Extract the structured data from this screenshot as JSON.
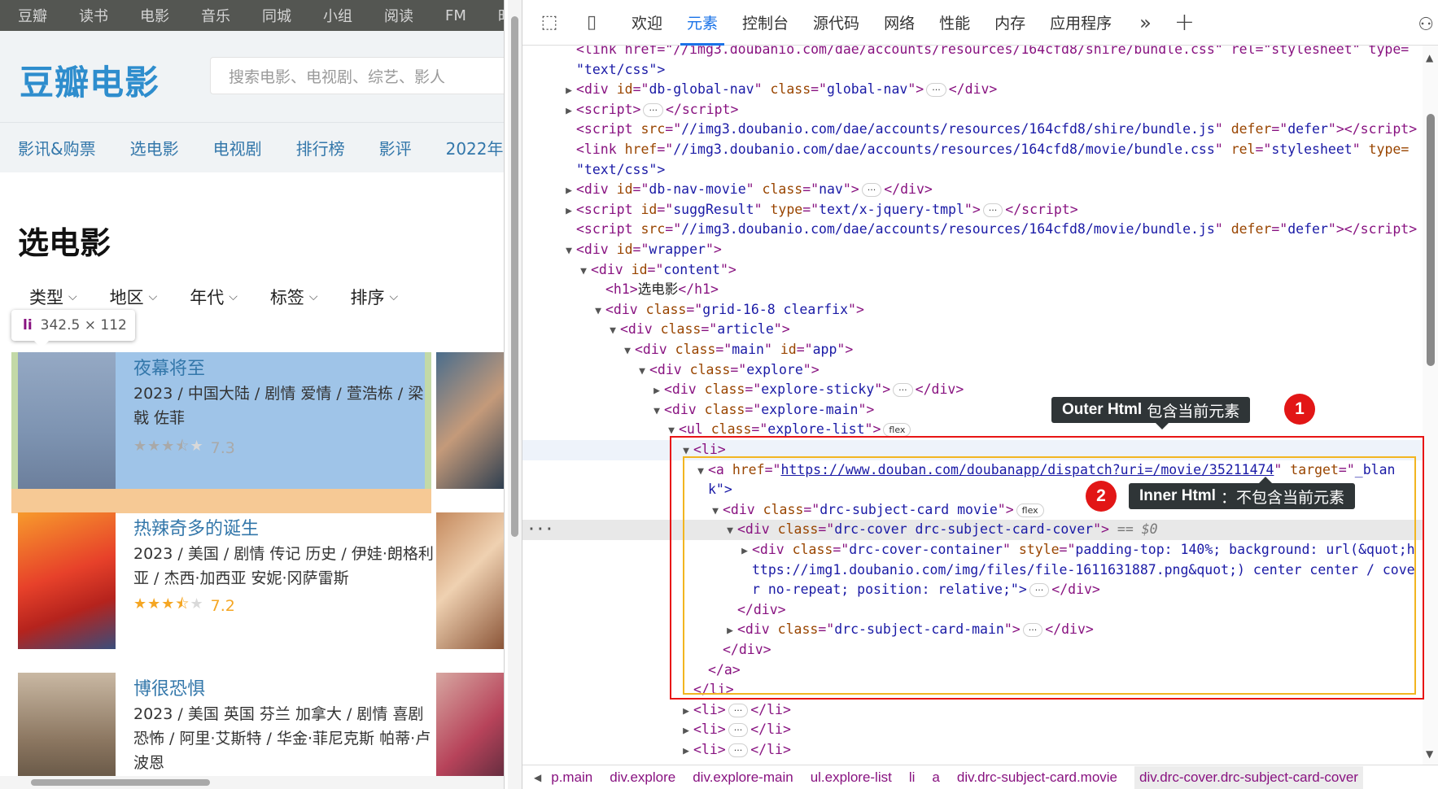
{
  "global_nav": [
    "豆瓣",
    "读书",
    "电影",
    "音乐",
    "同城",
    "小组",
    "阅读",
    "FM",
    "时间"
  ],
  "logo": "豆瓣电影",
  "search": {
    "placeholder": "搜索电影、电视剧、综艺、影人"
  },
  "movie_nav": [
    "影讯&购票",
    "选电影",
    "电视剧",
    "排行榜",
    "影评",
    "2022年"
  ],
  "page_title": "选电影",
  "filters": [
    "类型",
    "地区",
    "年代",
    "标签",
    "排序"
  ],
  "tooltip": {
    "tag": "li",
    "dims": "342.5 × 112"
  },
  "movies": [
    {
      "title": "夜幕将至",
      "meta": "2023 / 中国大陆 / 剧情 爱情 / 萱浩栋 / 梁戟 佐菲",
      "score": "7.3",
      "stars": 3.5
    },
    {
      "title": "热辣奇多的诞生",
      "meta": "2023 / 美国 / 剧情 传记 历史 / 伊娃·朗格利亚 / 杰西·加西亚 安妮·冈萨雷斯",
      "score": "7.2",
      "stars": 3.5
    },
    {
      "title": "博很恐惧",
      "meta": "2023 / 美国 英国 芬兰 加拿大 / 剧情 喜剧 恐怖 / 阿里·艾斯特 / 华金·菲尼克斯 帕蒂·卢波恩",
      "score": "",
      "stars": 0
    }
  ],
  "devtools": {
    "tabs": [
      "欢迎",
      "元素",
      "控制台",
      "源代码",
      "网络",
      "性能",
      "内存",
      "应用程序"
    ],
    "active_tab": "元素",
    "more_icon": "double-chevron-right-icon",
    "add_icon": "plus-icon"
  },
  "dom": {
    "r0": "<link href=\"//img3.doubanio.com/dae/accounts/resources/164cfd8/shire/bundle.css\" rel=\"stylesheet\" type=",
    "r1": "\"text/css\">",
    "r2_tag": "div",
    "r2_id": "db-global-nav",
    "r2_class": "global-nav",
    "r3_tag": "script",
    "r4_src": "//img3.doubanio.com/dae/accounts/resources/164cfd8/shire/bundle.js",
    "r4_defer": "defer",
    "r5_href": "//img3.doubanio.com/dae/accounts/resources/164cfd8/movie/bundle.css",
    "r5_rel": "stylesheet",
    "r6": "\"text/css\">",
    "r7_id": "db-nav-movie",
    "r7_class": "nav",
    "r8_id": "suggResult",
    "r8_type": "text/x-jquery-tmpl",
    "r9_src": "//img3.doubanio.com/dae/accounts/resources/164cfd8/movie/bundle.js",
    "r10_id": "wrapper",
    "r11_id": "content",
    "r12_text": "选电影",
    "r13_class": "grid-16-8 clearfix",
    "r14_class": "article",
    "r15_class": "main",
    "r15_id": "app",
    "r16_class": "explore",
    "r17_class": "explore-sticky",
    "r18_class": "explore-main",
    "r19_class": "explore-list",
    "flex_badge": "flex",
    "r21_href": "https://www.douban.com/doubanapp/dispatch?uri=/movie/35211474",
    "r21_target": "_blan",
    "r22": "k\">",
    "r23_class": "drc-subject-card movie",
    "r24_class": "drc-cover drc-subject-card-cover",
    "r24_eq": "== $0",
    "r25_class": "drc-cover-container",
    "r25_style": "padding-top: 140%; background: url(&quot;h",
    "r26": "ttps://img1.doubanio.com/img/files/file-1611631887.png&quot;) center center / cove",
    "r27": "r no-repeat; position: relative;\">",
    "r29_class": "drc-subject-card-main"
  },
  "callouts": {
    "outer_bold": "Outer Html",
    "outer_text": "包含当前元素",
    "outer_num": "1",
    "inner_bold": "Inner Html",
    "inner_text": "：不包含当前元素",
    "inner_num": "2"
  },
  "breadcrumbs": [
    "p.main",
    "div.explore",
    "div.explore-main",
    "ul.explore-list",
    "li",
    "a",
    "div.drc-subject-card.movie",
    "div.drc-cover.drc-subject-card-cover"
  ]
}
